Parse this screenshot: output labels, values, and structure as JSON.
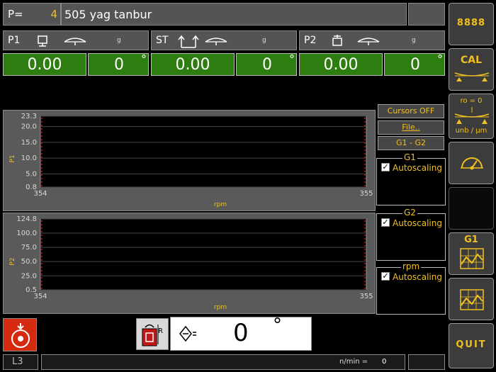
{
  "program": {
    "label": "P=",
    "number": "4",
    "name": "505 yag tanbur"
  },
  "channels": [
    {
      "name": "P1",
      "unit": "g",
      "value": "0.00",
      "angle": "0"
    },
    {
      "name": "ST",
      "unit": "g",
      "value": "0.00",
      "angle": "0"
    },
    {
      "name": "P2",
      "unit": "g",
      "value": "0.00",
      "angle": "0"
    }
  ],
  "degree_symbol": "°",
  "side_buttons": {
    "digits": "8888",
    "cal": "CAL",
    "ro_label": "ro = 0",
    "unb_label": "unb / µm",
    "g1": "G1",
    "quit": "QUIT"
  },
  "controls": {
    "cursors": "Cursors OFF",
    "file": "File..",
    "g1g2": "G1 - G2"
  },
  "groups": [
    {
      "title": "G1",
      "autoscaling_label": "Autoscaling",
      "checked": true
    },
    {
      "title": "G2",
      "autoscaling_label": "Autoscaling",
      "checked": true
    },
    {
      "title": "rpm",
      "autoscaling_label": "Autoscaling",
      "checked": true
    }
  ],
  "chart_data": [
    {
      "type": "line",
      "ylabel": "P1",
      "xlabel": "rpm",
      "yticks": [
        "23.3",
        "20.0",
        "15.0",
        "10.0",
        "5.0",
        "0.8"
      ],
      "ytick_values": [
        23.3,
        20.0,
        15.0,
        10.0,
        5.0,
        0.8
      ],
      "ylim": [
        0.8,
        23.3
      ],
      "xticks": [
        "354",
        "355"
      ],
      "xlim": [
        354,
        355
      ],
      "grid": true,
      "series_color": "#d01010"
    },
    {
      "type": "line",
      "ylabel": "P2",
      "xlabel": "rpm",
      "yticks": [
        "124.8",
        "100.0",
        "75.0",
        "50.0",
        "25.0",
        "0.5"
      ],
      "ytick_values": [
        124.8,
        100.0,
        75.0,
        50.0,
        25.0,
        0.5
      ],
      "ylim": [
        0.5,
        124.8
      ],
      "xticks": [
        "354",
        "355"
      ],
      "xlim": [
        354,
        355
      ],
      "grid": true,
      "series_color": "#d01010"
    }
  ],
  "bottom": {
    "angle_value": "0",
    "status": "L3",
    "nmin_label": "n/min =",
    "nmin_value": "0",
    "r_label": "R"
  },
  "colors": {
    "accent": "#f0c020",
    "value_bg": "#2e7d10",
    "trace": "#d01010"
  }
}
